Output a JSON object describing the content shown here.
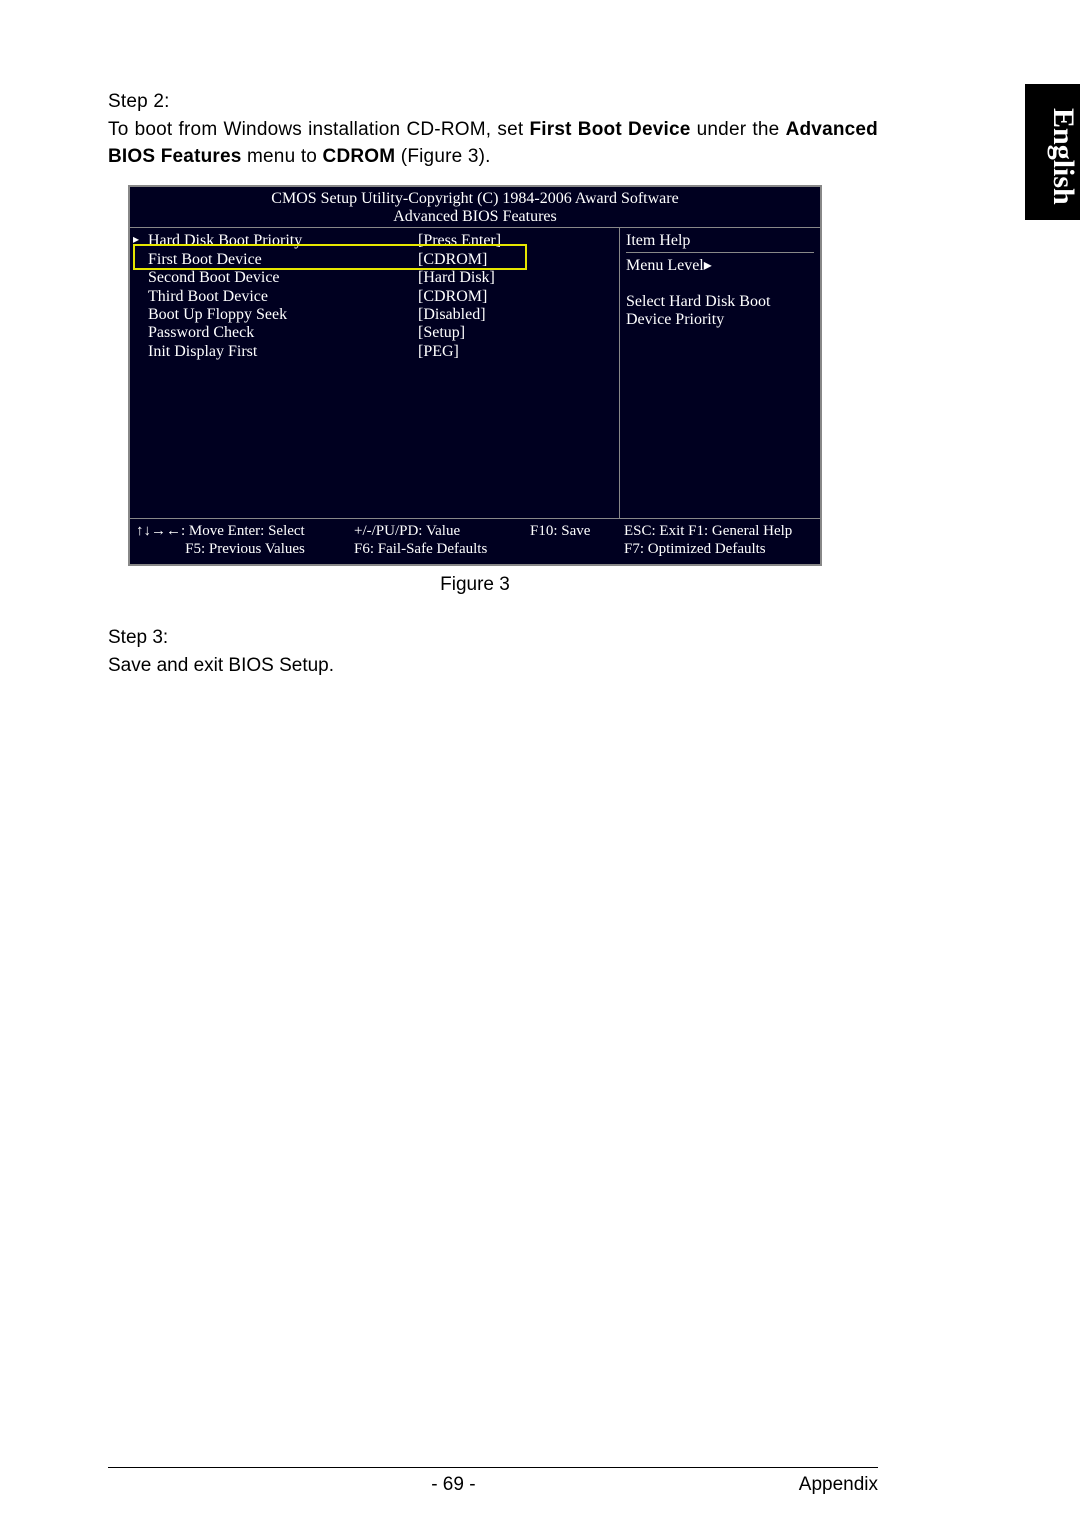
{
  "sidebar": {
    "language": "English"
  },
  "step2": {
    "heading": "Step 2:",
    "text_parts": [
      "To boot from Windows installation CD-ROM, set ",
      "First Boot Device",
      " under the ",
      "Advanced BIOS Features",
      " menu to ",
      "CDROM",
      " (Figure 3)."
    ]
  },
  "bios": {
    "header_line1": "CMOS Setup Utility-Copyright (C) 1984-2006 Award Software",
    "header_line2": "Advanced BIOS Features",
    "items": [
      {
        "label": "Hard Disk Boot Priority",
        "value": "[Press Enter]"
      },
      {
        "label": "First Boot Device",
        "value": "[CDROM]"
      },
      {
        "label": "Second Boot Device",
        "value": "[Hard Disk]"
      },
      {
        "label": "Third Boot Device",
        "value": "[CDROM]"
      },
      {
        "label": "Boot Up Floppy Seek",
        "value": "[Disabled]"
      },
      {
        "label": "Password Check",
        "value": "[Setup]"
      },
      {
        "label": "Init Display First",
        "value": "[PEG]"
      }
    ],
    "help": {
      "title": "Item Help",
      "menu_level": "Menu Level▸",
      "hint1": "Select Hard Disk Boot",
      "hint2": "Device Priority"
    },
    "footer": {
      "r1c1": "↑↓→←: Move      Enter: Select",
      "r1c2": "+/-/PU/PD: Value",
      "r1c3": "F10: Save",
      "r1c4": "ESC: Exit          F1: General Help",
      "r2c1": "F5: Previous Values",
      "r2c2": "F6: Fail-Safe Defaults",
      "r2c3": "",
      "r2c4": "F7: Optimized Defaults"
    }
  },
  "figure_caption": "Figure 3",
  "step3": {
    "heading": "Step 3:",
    "text": "Save and exit BIOS Setup."
  },
  "footer": {
    "page_number": "- 69 -",
    "section": "Appendix"
  }
}
